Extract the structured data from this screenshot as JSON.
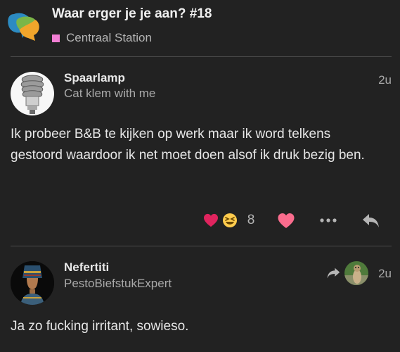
{
  "topic": {
    "title": "Waar erger je je aan? #18",
    "category": "Centraal Station",
    "category_color": "#f27fd4"
  },
  "posts": [
    {
      "username": "Spaarlamp",
      "user_title": "Cat klem with me",
      "age": "2u",
      "body": "Ik probeer B&B te kijken op werk maar ik word telkens gestoord waardoor ik net moet doen alsof ik druk bezig ben.",
      "reactions": {
        "icons": [
          "heart-emoji",
          "grinning-squinting-emoji"
        ],
        "count": "8"
      },
      "actions": [
        "like-heart",
        "more-ellipsis",
        "reply"
      ]
    },
    {
      "username": "Nefertiti",
      "user_title": "PestoBiefstukExpert",
      "age": "2u",
      "body": "Ja zo fucking irritant, sowieso.",
      "reply_indicator": "reply-arrow-with-avatar"
    }
  ],
  "colors": {
    "background": "#222222",
    "like_heart": "#fa6c8d",
    "reaction_heart": "#e0245e"
  }
}
